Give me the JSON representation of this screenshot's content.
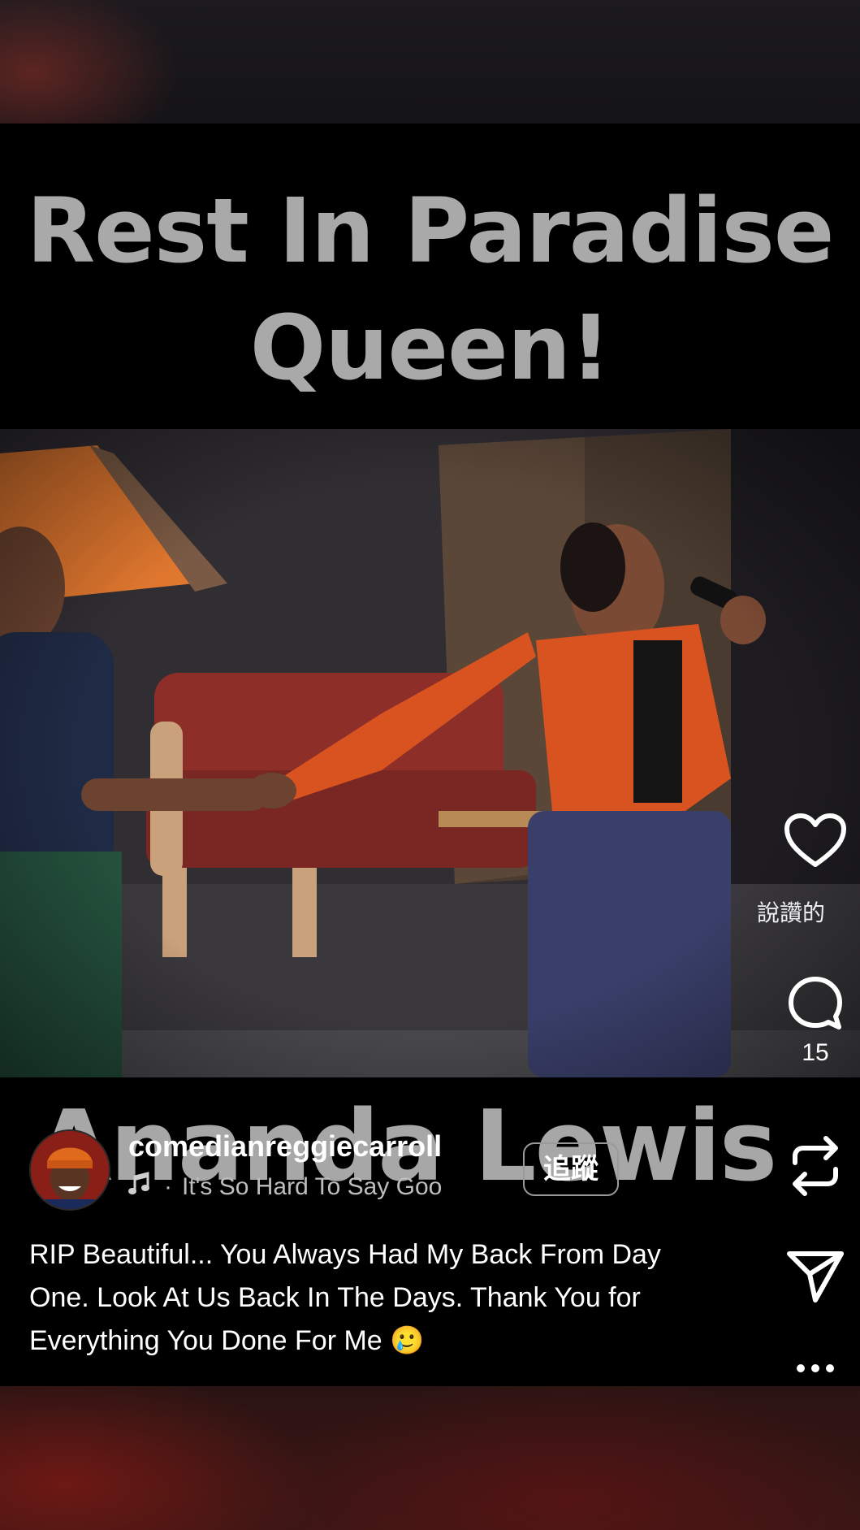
{
  "video": {
    "headline_line1": "Rest In Paradise",
    "headline_line2": "Queen!",
    "name_caption": "Ananda Lewis",
    "overlay_text": "說讚的"
  },
  "rail": {
    "like_icon": "heart-icon",
    "comment_icon": "comment-icon",
    "comment_count": "15",
    "repost_icon": "repost-icon",
    "share_icon": "send-icon",
    "more_icon": "more-icon"
  },
  "post": {
    "username": "comedianreggiecarroll",
    "audio_separator": "·",
    "audio_track": "It's So Hard To Say Goo",
    "follow_label": "追蹤",
    "caption": "RIP Beautiful... You Always Had My Back From Day One. Look At Us Back In The Days. Thank You for Everything You Done For Me 🥲"
  },
  "colors": {
    "headline_gray": "#a9a9a9",
    "jacket_orange": "#d8531f"
  }
}
